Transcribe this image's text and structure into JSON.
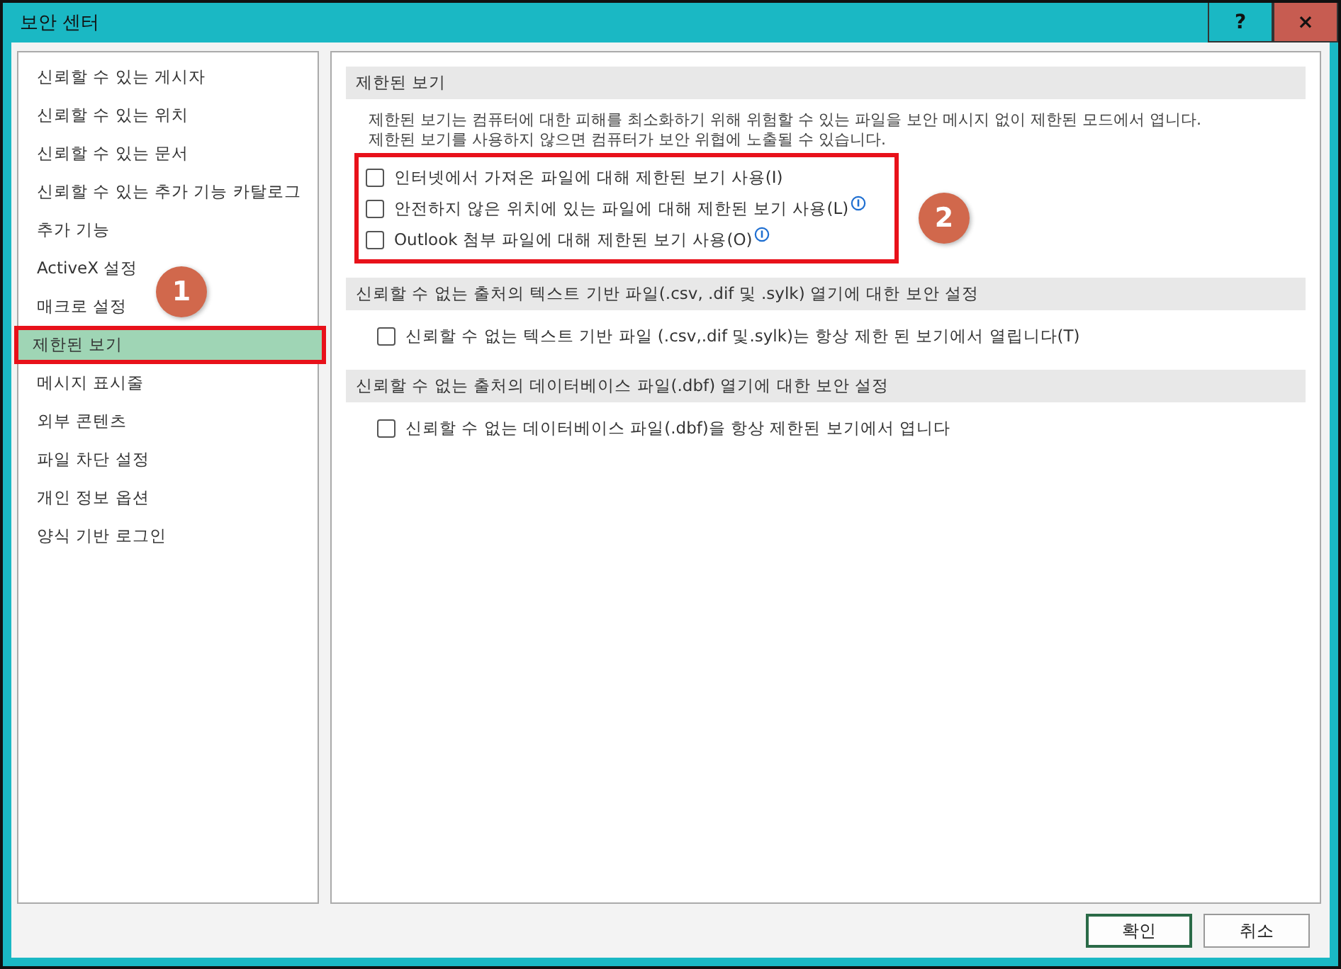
{
  "window": {
    "title": "보안 센터",
    "help": "?",
    "close": "×"
  },
  "sidebar": {
    "items": [
      {
        "label": "신뢰할 수 있는 게시자",
        "selected": false
      },
      {
        "label": "신뢰할 수 있는 위치",
        "selected": false
      },
      {
        "label": "신뢰할 수 있는 문서",
        "selected": false
      },
      {
        "label": "신뢰할 수 있는 추가 기능 카탈로그",
        "selected": false
      },
      {
        "label": "추가 기능",
        "selected": false
      },
      {
        "label": "ActiveX 설정",
        "selected": false
      },
      {
        "label": "매크로 설정",
        "selected": false
      },
      {
        "label": "제한된 보기",
        "selected": true
      },
      {
        "label": "메시지 표시줄",
        "selected": false
      },
      {
        "label": "외부 콘텐츠",
        "selected": false
      },
      {
        "label": "파일 차단 설정",
        "selected": false
      },
      {
        "label": "개인 정보 옵션",
        "selected": false
      },
      {
        "label": "양식 기반 로그인",
        "selected": false
      }
    ]
  },
  "sections": [
    {
      "heading": "제한된 보기",
      "description": [
        "제한된 보기는 컴퓨터에 대한 피해를 최소화하기 위해 위험할 수 있는 파일을 보안 메시지 없이 제한된 모드에서 엽니다.",
        "제한된 보기를 사용하지 않으면 컴퓨터가 보안 위협에 노출될 수 있습니다."
      ],
      "highlighted": true,
      "options": [
        {
          "label": "인터넷에서 가져온 파일에 대해 제한된 보기 사용(I)",
          "checked": false,
          "info": false
        },
        {
          "label": "안전하지 않은 위치에 있는 파일에 대해 제한된 보기 사용(L)",
          "checked": false,
          "info": true
        },
        {
          "label": "Outlook 첨부 파일에 대해 제한된 보기 사용(O)",
          "checked": false,
          "info": true
        }
      ]
    },
    {
      "heading": "신뢰할 수 없는 출처의 텍스트 기반 파일(.csv, .dif 및 .sylk) 열기에 대한 보안 설정",
      "highlighted": false,
      "options": [
        {
          "label": "신뢰할 수 없는 텍스트 기반 파일 (.csv,.dif 및.sylk)는 항상 제한 된 보기에서 열립니다(T)",
          "checked": false,
          "info": false
        }
      ]
    },
    {
      "heading": "신뢰할 수 없는 출처의 데이터베이스 파일(.dbf) 열기에 대한 보안 설정",
      "highlighted": false,
      "options": [
        {
          "label": "신뢰할 수 없는 데이터베이스 파일(.dbf)을 항상 제한된 보기에서 엽니다",
          "checked": false,
          "info": false
        }
      ]
    }
  ],
  "callouts": [
    "1",
    "2"
  ],
  "buttons": [
    {
      "label": "확인",
      "default": true
    },
    {
      "label": "취소",
      "default": false
    }
  ]
}
